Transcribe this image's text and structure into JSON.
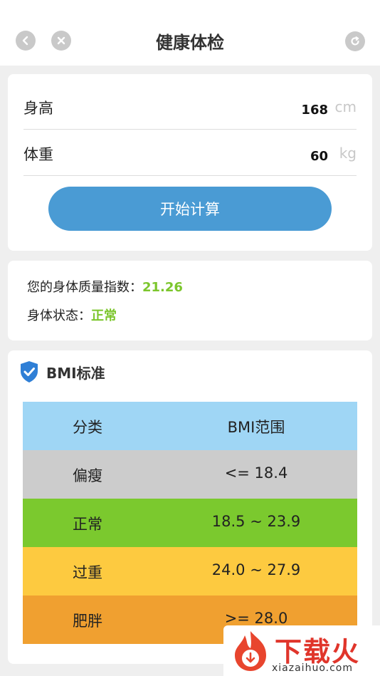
{
  "header": {
    "title": "健康体检",
    "back_icon": "chevron-left-icon",
    "close_icon": "close-icon",
    "refresh_icon": "refresh-icon"
  },
  "form": {
    "height": {
      "label": "身高",
      "value": "168",
      "unit": "cm"
    },
    "weight": {
      "label": "体重",
      "value": "60",
      "unit": "kg"
    },
    "calculate_button": "开始计算"
  },
  "result": {
    "bmi_label": "您的身体质量指数：",
    "bmi_value": "21.26",
    "status_label": "身体状态：",
    "status_value": "正常",
    "highlight_color": "#7cc62d"
  },
  "standard": {
    "title": "BMI标准",
    "icon": "shield-check-icon",
    "table": {
      "headers": {
        "category": "分类",
        "range": "BMI范围",
        "color": "#9fd6f5"
      },
      "rows": [
        {
          "category": "偏瘦",
          "range": "<= 18.4",
          "color": "#cccccc"
        },
        {
          "category": "正常",
          "range": "18.5 ~ 23.9",
          "color": "#7bc92e"
        },
        {
          "category": "过重",
          "range": "24.0 ~ 27.9",
          "color": "#fdca40"
        },
        {
          "category": "肥胖",
          "range": ">= 28.0",
          "color": "#f0a030"
        }
      ]
    }
  },
  "watermark": {
    "brand": "下载火",
    "domain": "xiazaihuo.com"
  }
}
